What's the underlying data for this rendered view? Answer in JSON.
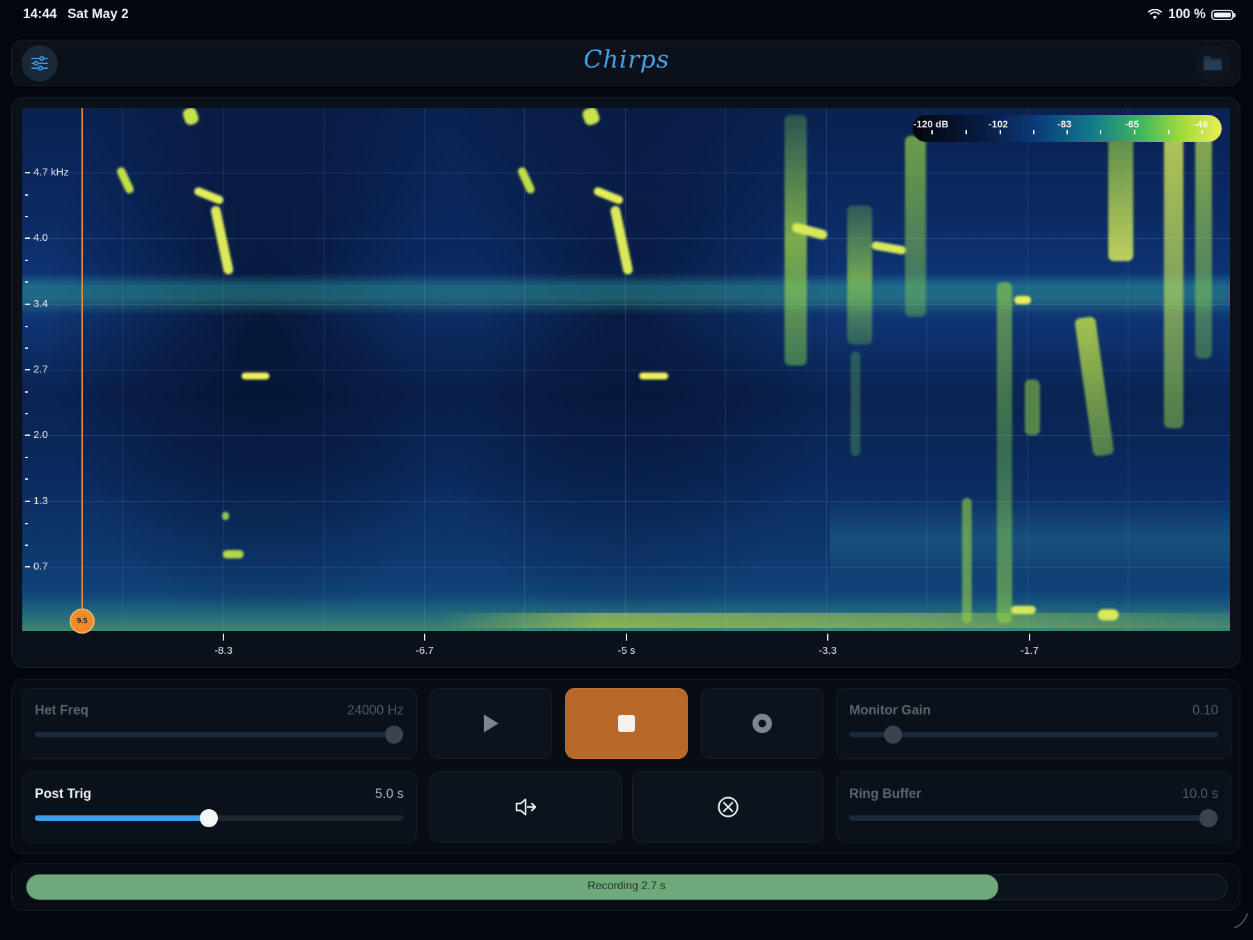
{
  "status_bar": {
    "time": "14:44",
    "date": "Sat May 2",
    "battery_text": "100 %"
  },
  "header": {
    "title": "Chirps",
    "menu_icon": "sliders-icon",
    "folder_icon": "folder-icon"
  },
  "spectrogram": {
    "y_labels": [
      "4.7 kHz",
      "4.0",
      "3.4",
      "2.7",
      "2.0",
      "1.3",
      "0.7"
    ],
    "x_labels": [
      "-8.3",
      "-6.7",
      "-5 s",
      "-3.3",
      "-1.7"
    ],
    "cursor_value": "9.5",
    "legend": {
      "labels": [
        "-120 dB",
        "-102",
        "-83",
        "-65",
        "-46"
      ],
      "colors": [
        "#04060e",
        "#0b3b78",
        "#127a8c",
        "#3fb75c",
        "#e8ec5a"
      ]
    }
  },
  "controls": {
    "het_freq": {
      "label": "Het Freq",
      "value": "24000 Hz",
      "level": 1.0
    },
    "monitor_gain": {
      "label": "Monitor Gain",
      "value": "0.10",
      "level": 0.1
    },
    "post_trig": {
      "label": "Post Trig",
      "value": "5.0 s",
      "level": 0.475
    },
    "ring_buffer": {
      "label": "Ring Buffer",
      "value": "10.0 s",
      "level": 1.0
    },
    "play_icon": "play-icon",
    "stop_icon": "stop-icon",
    "record_icon": "record-icon",
    "speaker_icon": "speaker-route-icon",
    "clear_icon": "clear-circle-icon",
    "accent_color": "#b8692a"
  },
  "recording": {
    "label": "Recording 2.7 s",
    "progress": 0.81,
    "color": "#6fa97a"
  }
}
